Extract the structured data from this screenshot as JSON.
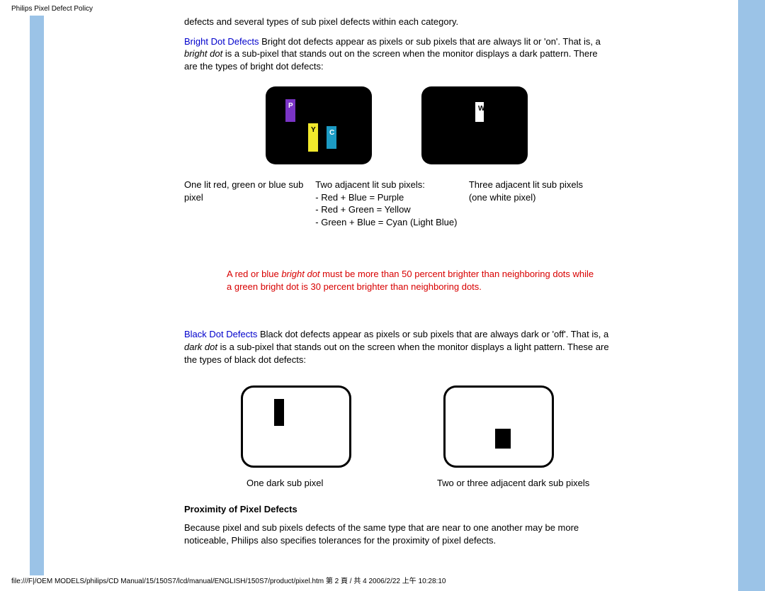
{
  "header": {
    "title": "Philips Pixel Defect Policy"
  },
  "intro_tail": "defects and several types of sub pixel defects within each category.",
  "bright": {
    "label": "Bright Dot Defects",
    "text_a": " Bright dot defects appear as pixels or sub pixels that are always lit or 'on'. That is, a ",
    "term": "bright dot",
    "text_b": " is a sub-pixel that stands out on the screen when the monitor displays a dark pattern. There are the types of bright dot defects:",
    "letters": {
      "p": "P",
      "y": "Y",
      "c": "C",
      "w": "W"
    },
    "cap1": "One lit red, green or blue sub pixel",
    "cap2_l1": "Two adjacent lit sub pixels:",
    "cap2_l2": "- Red + Blue = Purple",
    "cap2_l3": "- Red + Green = Yellow",
    "cap2_l4": "- Green + Blue = Cyan (Light Blue)",
    "cap3_l1": "Three adjacent lit sub pixels",
    "cap3_l2": "(one white pixel)"
  },
  "redline": {
    "a": "A red or blue ",
    "term": "bright dot",
    "b": " must be more than 50 percent brighter than neighboring dots while a green bright dot is 30 percent brighter than neighboring dots."
  },
  "black": {
    "label": "Black Dot Defects",
    "text_a": " Black dot defects appear as pixels or sub pixels that are always dark or 'off'. That is, a ",
    "term": "dark dot",
    "text_b": " is a sub-pixel that stands out on the screen when the monitor displays a light pattern. These are the types of black dot defects:",
    "cap1": "One dark sub pixel",
    "cap2": "Two or three adjacent dark sub pixels"
  },
  "proximity": {
    "title": "Proximity of Pixel Defects",
    "text": "Because pixel and sub pixels defects of the same type that are near to one another may be more noticeable, Philips also specifies tolerances for the proximity of pixel defects."
  },
  "footer": "file:///F|/OEM MODELS/philips/CD Manual/15/150S7/lcd/manual/ENGLISH/150S7/product/pixel.htm 第 2 頁 / 共 4 2006/2/22 上午 10:28:10"
}
